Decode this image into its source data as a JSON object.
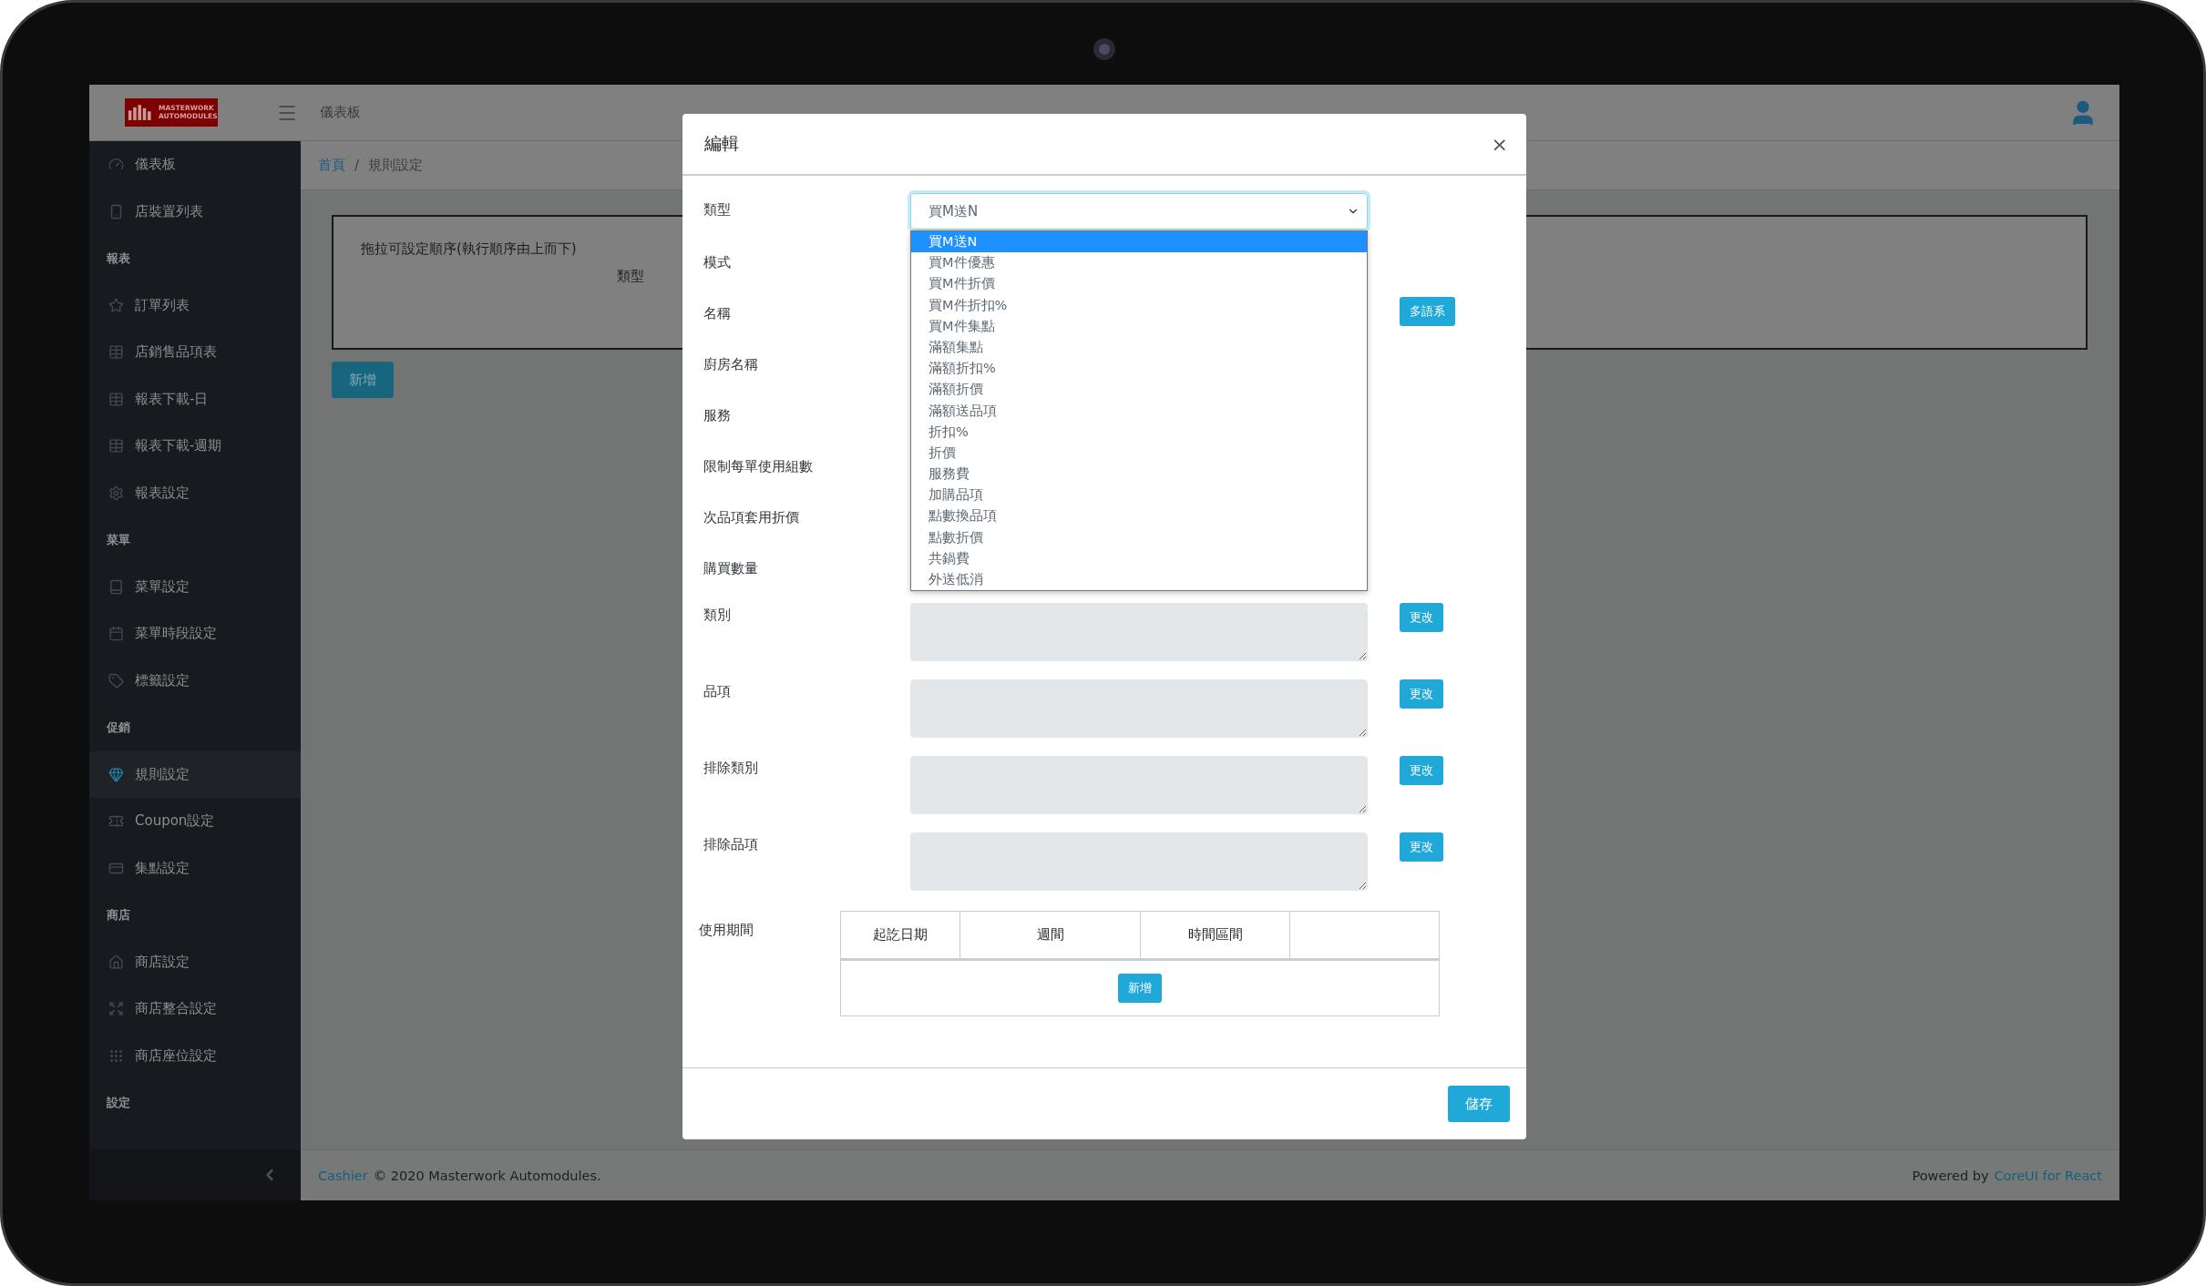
{
  "header": {
    "logo_text": "MASTERWORK AUTOMODULES",
    "title": "儀表板"
  },
  "sidebar": {
    "items": [
      {
        "kind": "link",
        "label": "儀表板",
        "selected": false
      },
      {
        "kind": "link",
        "label": "店裝置列表",
        "selected": false
      },
      {
        "kind": "title",
        "label": "報表"
      },
      {
        "kind": "link",
        "label": "訂單列表",
        "selected": false
      },
      {
        "kind": "link",
        "label": "店銷售品項表",
        "selected": false
      },
      {
        "kind": "link",
        "label": "報表下載-日",
        "selected": false
      },
      {
        "kind": "link",
        "label": "報表下載-週期",
        "selected": false
      },
      {
        "kind": "link",
        "label": "報表設定",
        "selected": false
      },
      {
        "kind": "title",
        "label": "菜單"
      },
      {
        "kind": "link",
        "label": "菜單設定",
        "selected": false
      },
      {
        "kind": "link",
        "label": "菜單時段設定",
        "selected": false
      },
      {
        "kind": "link",
        "label": "標籤設定",
        "selected": false
      },
      {
        "kind": "title",
        "label": "促銷"
      },
      {
        "kind": "link",
        "label": "規則設定",
        "selected": true
      },
      {
        "kind": "link",
        "label": "Coupon設定",
        "selected": false
      },
      {
        "kind": "link",
        "label": "集點設定",
        "selected": false
      },
      {
        "kind": "title",
        "label": "商店"
      },
      {
        "kind": "link",
        "label": "商店設定",
        "selected": false
      },
      {
        "kind": "link",
        "label": "商店整合設定",
        "selected": false
      },
      {
        "kind": "link",
        "label": "商店座位設定",
        "selected": false
      },
      {
        "kind": "title",
        "label": "設定"
      }
    ]
  },
  "breadcrumb": {
    "items": [
      "首頁",
      "規則設定"
    ],
    "separator": "/"
  },
  "card": {
    "hint": "拖拉可設定順序(執行順序由上而下)",
    "column_header": "類型"
  },
  "add_button": "新增",
  "footer": {
    "brand": "Cashier",
    "copyright": "© 2020 Masterwork Automodules.",
    "powered_by": "Powered by",
    "framework": "CoreUI for React"
  },
  "modal": {
    "title": "編輯",
    "close": "×",
    "fields": [
      {
        "label": "類型",
        "kind": "select",
        "value": "買M送N",
        "options": [
          {
            "label": "買M送N",
            "selected": true
          },
          {
            "label": "買M件優惠",
            "selected": false
          },
          {
            "label": "買M件折價",
            "selected": false
          },
          {
            "label": "買M件折扣%",
            "selected": false
          },
          {
            "label": "買M件集點",
            "selected": false
          },
          {
            "label": "滿額集點",
            "selected": false
          },
          {
            "label": "滿額折扣%",
            "selected": false
          },
          {
            "label": "滿額折價",
            "selected": false
          },
          {
            "label": "滿額送品項",
            "selected": false
          },
          {
            "label": "折扣%",
            "selected": false
          },
          {
            "label": "折價",
            "selected": false
          },
          {
            "label": "服務費",
            "selected": false
          },
          {
            "label": "加購品項",
            "selected": false
          },
          {
            "label": "點數換品項",
            "selected": false
          },
          {
            "label": "點數折價",
            "selected": false
          },
          {
            "label": "共鍋費",
            "selected": false
          },
          {
            "label": "外送低消",
            "selected": false
          }
        ]
      },
      {
        "label": "模式",
        "kind": "covered"
      },
      {
        "label": "名稱",
        "kind": "covered",
        "button": "多語系"
      },
      {
        "label": "廚房名稱",
        "kind": "covered"
      },
      {
        "label": "服務",
        "kind": "covered"
      },
      {
        "label": "限制每單使用組數",
        "kind": "covered"
      },
      {
        "label": "次品項套用折價",
        "kind": "covered"
      },
      {
        "label": "購買數量",
        "kind": "covered"
      },
      {
        "label": "類別",
        "kind": "textarea",
        "button": "更改"
      },
      {
        "label": "品項",
        "kind": "textarea",
        "button": "更改"
      },
      {
        "label": "排除類別",
        "kind": "textarea",
        "button": "更改"
      },
      {
        "label": "排除品項",
        "kind": "textarea",
        "button": "更改"
      }
    ],
    "period": {
      "label": "使用期間",
      "columns": [
        "起訖日期",
        "週間",
        "時間區間"
      ],
      "add_button": "新增"
    },
    "save_button": "儲存"
  }
}
